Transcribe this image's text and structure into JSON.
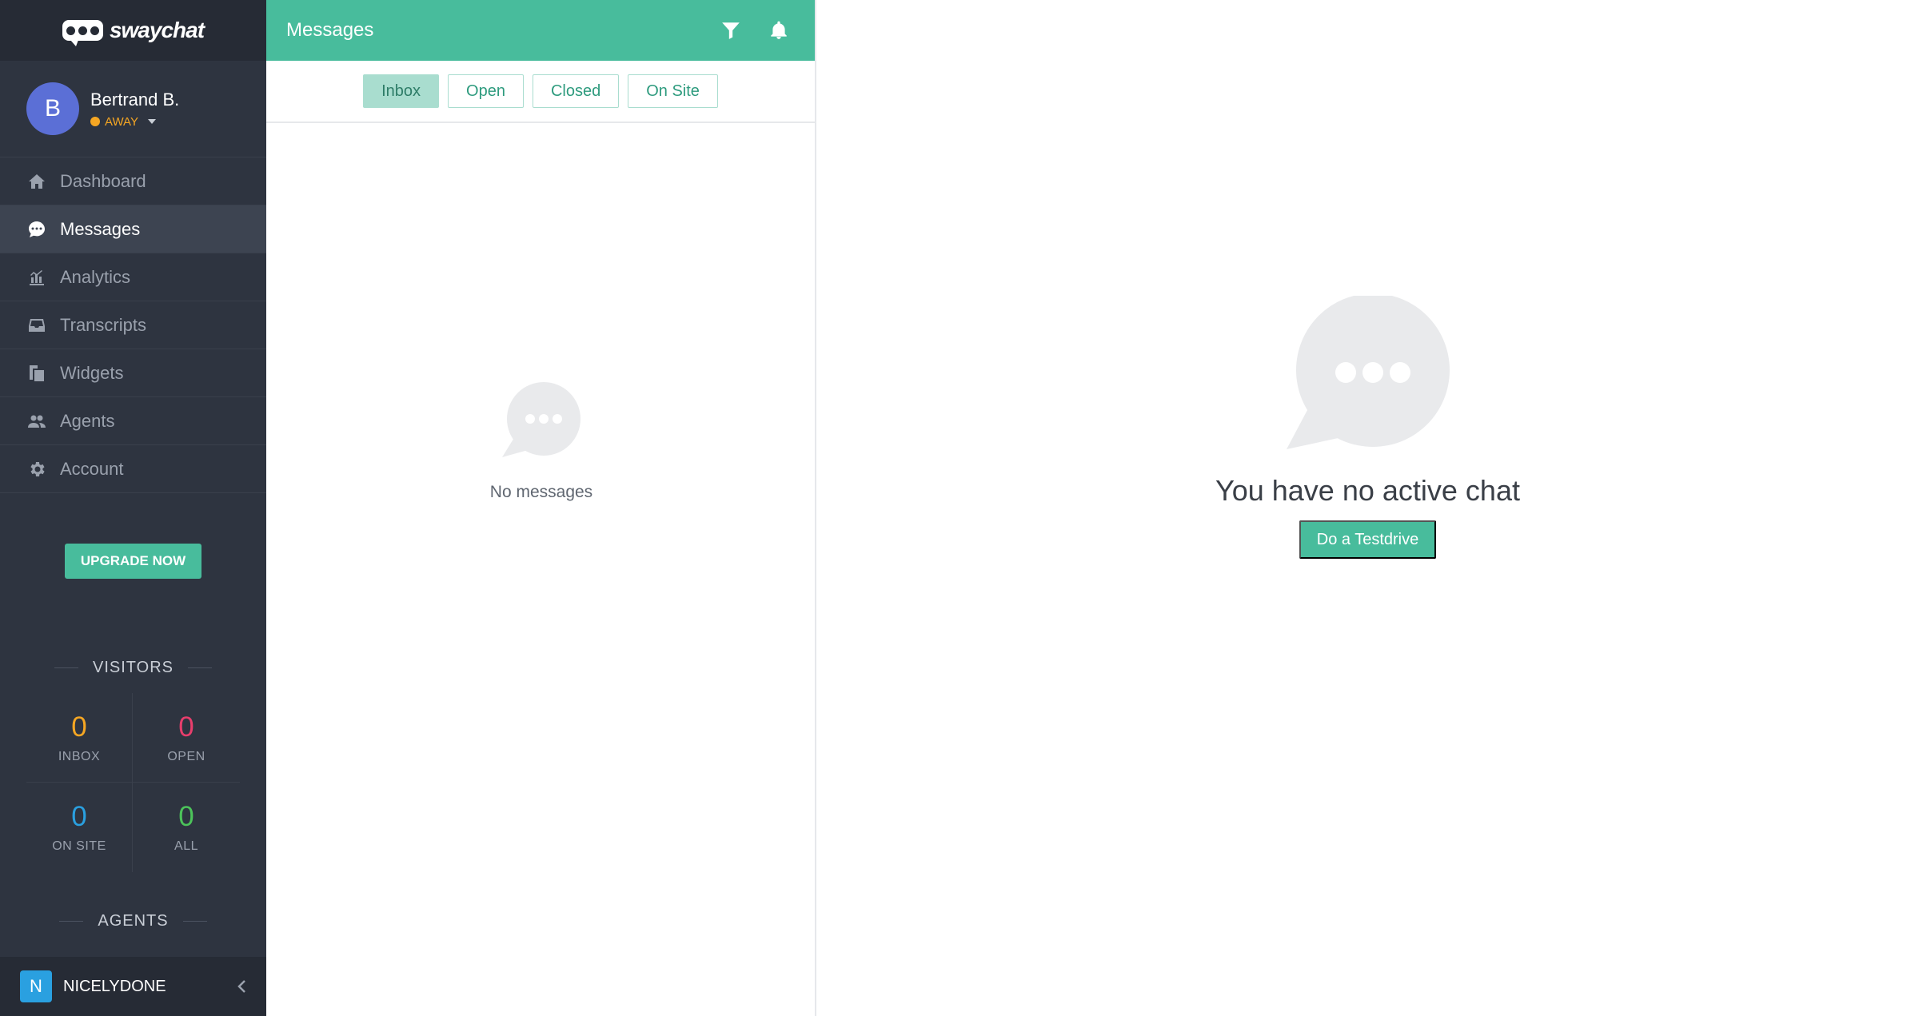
{
  "brand": {
    "name": "swaychat"
  },
  "user": {
    "initial": "B",
    "name": "Bertrand B.",
    "status": "AWAY"
  },
  "nav": [
    {
      "label": "Dashboard",
      "icon": "home-icon"
    },
    {
      "label": "Messages",
      "icon": "chat-icon",
      "active": true
    },
    {
      "label": "Analytics",
      "icon": "bar-chart-icon"
    },
    {
      "label": "Transcripts",
      "icon": "inbox-icon"
    },
    {
      "label": "Widgets",
      "icon": "widgets-icon"
    },
    {
      "label": "Agents",
      "icon": "users-icon"
    },
    {
      "label": "Account",
      "icon": "gear-icon"
    }
  ],
  "upgrade_label": "UPGRADE NOW",
  "visitors": {
    "title": "VISITORS",
    "stats": [
      {
        "label": "INBOX",
        "value": "0",
        "color": "#f5a623"
      },
      {
        "label": "OPEN",
        "value": "0",
        "color": "#e83e6c"
      },
      {
        "label": "ON SITE",
        "value": "0",
        "color": "#2aa0e0"
      },
      {
        "label": "ALL",
        "value": "0",
        "color": "#4cc35a"
      }
    ]
  },
  "agents_title": "AGENTS",
  "org": {
    "initial": "N",
    "name": "NICELYDONE"
  },
  "messages": {
    "title": "Messages",
    "tabs": [
      "Inbox",
      "Open",
      "Closed",
      "On Site"
    ],
    "active_tab": "Inbox",
    "empty_text": "No messages"
  },
  "main": {
    "empty_title": "You have no active chat",
    "testdrive_label": "Do a Testdrive"
  },
  "colors": {
    "accent": "#48bc9c",
    "sidebar": "#2e3440",
    "away": "#f5a623"
  }
}
